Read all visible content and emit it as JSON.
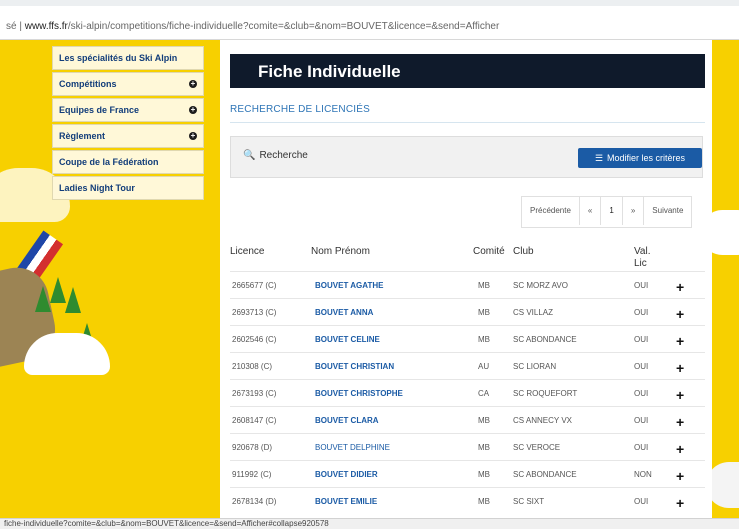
{
  "browser": {
    "address_prefix": "sé |",
    "address_host": "www.ffs.fr",
    "address_path": "/ski-alpin/competitions/fiche-individuelle?comite=&club=&nom=BOUVET&licence=&send=Afficher",
    "status_url": "fiche-individuelle?comite=&club=&nom=BOUVET&licence=&send=Afficher#collapse920578"
  },
  "menu": {
    "items": [
      {
        "label": "Les spécialités du Ski Alpin",
        "has_plus": false
      },
      {
        "label": "Compétitions",
        "has_plus": true
      },
      {
        "label": "Equipes de France",
        "has_plus": true
      },
      {
        "label": "Règlement",
        "has_plus": true
      },
      {
        "label": "Coupe de la Fédération",
        "has_plus": false
      },
      {
        "label": "Ladies Night Tour",
        "has_plus": false
      }
    ]
  },
  "page": {
    "title": "Fiche Individuelle",
    "subtitle": "RECHERCHE DE LICENCIÉS",
    "search_label": "Recherche",
    "modify_button": "Modifier les critères"
  },
  "pager": {
    "previous": "Précédente",
    "first": "«",
    "current": "1",
    "last": "»",
    "next": "Suivante"
  },
  "table": {
    "headers": {
      "licence": "Licence",
      "name": "Nom Prénom",
      "comite": "Comité",
      "club": "Club",
      "val1": "Val.",
      "val2": "Lic"
    },
    "rows": [
      {
        "licence": "2665677 (C)",
        "name": "BOUVET AGATHE",
        "comite": "MB",
        "club": "SC MORZ AVO",
        "val": "OUI"
      },
      {
        "licence": "2693713 (C)",
        "name": "BOUVET ANNA",
        "comite": "MB",
        "club": "CS VILLAZ",
        "val": "OUI"
      },
      {
        "licence": "2602546 (C)",
        "name": "BOUVET CELINE",
        "comite": "MB",
        "club": "SC ABONDANCE",
        "val": "OUI"
      },
      {
        "licence": "210308 (C)",
        "name": "BOUVET CHRISTIAN",
        "comite": "AU",
        "club": "SC LIORAN",
        "val": "OUI"
      },
      {
        "licence": "2673193 (C)",
        "name": "BOUVET CHRISTOPHE",
        "comite": "CA",
        "club": "SC ROQUEFORT",
        "val": "OUI"
      },
      {
        "licence": "2608147 (C)",
        "name": "BOUVET CLARA",
        "comite": "MB",
        "club": "CS ANNECY VX",
        "val": "OUI"
      },
      {
        "licence": "920678 (D)",
        "name": "BOUVET DELPHINE",
        "comite": "MB",
        "club": "SC VEROCE",
        "val": "OUI"
      },
      {
        "licence": "911992 (C)",
        "name": "BOUVET DIDIER",
        "comite": "MB",
        "club": "SC ABONDANCE",
        "val": "NON"
      },
      {
        "licence": "2678134 (D)",
        "name": "BOUVET EMILIE",
        "comite": "MB",
        "club": "SC SIXT",
        "val": "OUI"
      }
    ]
  }
}
